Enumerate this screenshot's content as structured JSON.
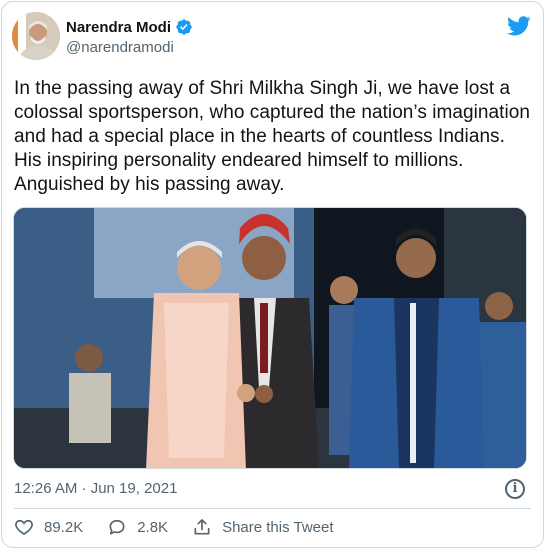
{
  "author": {
    "name": "Narendra Modi",
    "handle": "@narendramodi"
  },
  "tweet": {
    "text": "In the passing away of Shri Milkha Singh Ji, we have lost a colossal sportsperson, who captured the nation’s imagination and had a special place in the hearts of countless Indians. His inspiring personality endeared himself to millions. Anguished by his passing away."
  },
  "meta": {
    "timestamp": "12:26 AM · Jun 19, 2021"
  },
  "actions": {
    "likes": "89.2K",
    "replies": "2.8K",
    "share_label": "Share this Tweet"
  },
  "icons": {
    "verified": "verified-badge-icon",
    "logo": "twitter-bird-icon",
    "info": "info-icon",
    "like": "heart-icon",
    "reply": "reply-bubble-icon",
    "share": "share-icon"
  },
  "colors": {
    "brand_blue": "#1d9bf0",
    "text_primary": "#0f1419",
    "text_secondary": "#536471",
    "border": "#cfd9de"
  }
}
